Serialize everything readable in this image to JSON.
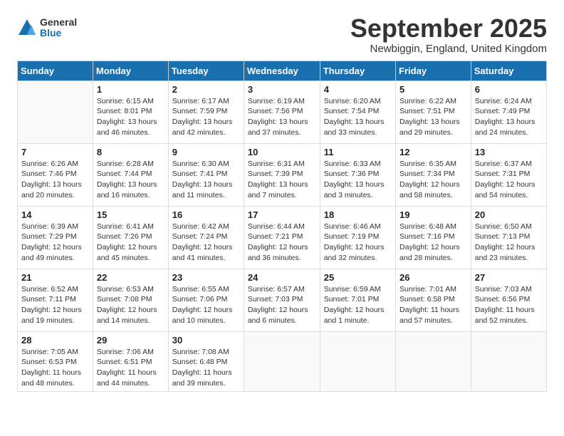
{
  "logo": {
    "general": "General",
    "blue": "Blue"
  },
  "title": "September 2025",
  "location": "Newbiggin, England, United Kingdom",
  "headers": [
    "Sunday",
    "Monday",
    "Tuesday",
    "Wednesday",
    "Thursday",
    "Friday",
    "Saturday"
  ],
  "weeks": [
    [
      {
        "day": "",
        "sunrise": "",
        "sunset": "",
        "daylight": ""
      },
      {
        "day": "1",
        "sunrise": "Sunrise: 6:15 AM",
        "sunset": "Sunset: 8:01 PM",
        "daylight": "Daylight: 13 hours and 46 minutes."
      },
      {
        "day": "2",
        "sunrise": "Sunrise: 6:17 AM",
        "sunset": "Sunset: 7:59 PM",
        "daylight": "Daylight: 13 hours and 42 minutes."
      },
      {
        "day": "3",
        "sunrise": "Sunrise: 6:19 AM",
        "sunset": "Sunset: 7:56 PM",
        "daylight": "Daylight: 13 hours and 37 minutes."
      },
      {
        "day": "4",
        "sunrise": "Sunrise: 6:20 AM",
        "sunset": "Sunset: 7:54 PM",
        "daylight": "Daylight: 13 hours and 33 minutes."
      },
      {
        "day": "5",
        "sunrise": "Sunrise: 6:22 AM",
        "sunset": "Sunset: 7:51 PM",
        "daylight": "Daylight: 13 hours and 29 minutes."
      },
      {
        "day": "6",
        "sunrise": "Sunrise: 6:24 AM",
        "sunset": "Sunset: 7:49 PM",
        "daylight": "Daylight: 13 hours and 24 minutes."
      }
    ],
    [
      {
        "day": "7",
        "sunrise": "Sunrise: 6:26 AM",
        "sunset": "Sunset: 7:46 PM",
        "daylight": "Daylight: 13 hours and 20 minutes."
      },
      {
        "day": "8",
        "sunrise": "Sunrise: 6:28 AM",
        "sunset": "Sunset: 7:44 PM",
        "daylight": "Daylight: 13 hours and 16 minutes."
      },
      {
        "day": "9",
        "sunrise": "Sunrise: 6:30 AM",
        "sunset": "Sunset: 7:41 PM",
        "daylight": "Daylight: 13 hours and 11 minutes."
      },
      {
        "day": "10",
        "sunrise": "Sunrise: 6:31 AM",
        "sunset": "Sunset: 7:39 PM",
        "daylight": "Daylight: 13 hours and 7 minutes."
      },
      {
        "day": "11",
        "sunrise": "Sunrise: 6:33 AM",
        "sunset": "Sunset: 7:36 PM",
        "daylight": "Daylight: 13 hours and 3 minutes."
      },
      {
        "day": "12",
        "sunrise": "Sunrise: 6:35 AM",
        "sunset": "Sunset: 7:34 PM",
        "daylight": "Daylight: 12 hours and 58 minutes."
      },
      {
        "day": "13",
        "sunrise": "Sunrise: 6:37 AM",
        "sunset": "Sunset: 7:31 PM",
        "daylight": "Daylight: 12 hours and 54 minutes."
      }
    ],
    [
      {
        "day": "14",
        "sunrise": "Sunrise: 6:39 AM",
        "sunset": "Sunset: 7:29 PM",
        "daylight": "Daylight: 12 hours and 49 minutes."
      },
      {
        "day": "15",
        "sunrise": "Sunrise: 6:41 AM",
        "sunset": "Sunset: 7:26 PM",
        "daylight": "Daylight: 12 hours and 45 minutes."
      },
      {
        "day": "16",
        "sunrise": "Sunrise: 6:42 AM",
        "sunset": "Sunset: 7:24 PM",
        "daylight": "Daylight: 12 hours and 41 minutes."
      },
      {
        "day": "17",
        "sunrise": "Sunrise: 6:44 AM",
        "sunset": "Sunset: 7:21 PM",
        "daylight": "Daylight: 12 hours and 36 minutes."
      },
      {
        "day": "18",
        "sunrise": "Sunrise: 6:46 AM",
        "sunset": "Sunset: 7:19 PM",
        "daylight": "Daylight: 12 hours and 32 minutes."
      },
      {
        "day": "19",
        "sunrise": "Sunrise: 6:48 AM",
        "sunset": "Sunset: 7:16 PM",
        "daylight": "Daylight: 12 hours and 28 minutes."
      },
      {
        "day": "20",
        "sunrise": "Sunrise: 6:50 AM",
        "sunset": "Sunset: 7:13 PM",
        "daylight": "Daylight: 12 hours and 23 minutes."
      }
    ],
    [
      {
        "day": "21",
        "sunrise": "Sunrise: 6:52 AM",
        "sunset": "Sunset: 7:11 PM",
        "daylight": "Daylight: 12 hours and 19 minutes."
      },
      {
        "day": "22",
        "sunrise": "Sunrise: 6:53 AM",
        "sunset": "Sunset: 7:08 PM",
        "daylight": "Daylight: 12 hours and 14 minutes."
      },
      {
        "day": "23",
        "sunrise": "Sunrise: 6:55 AM",
        "sunset": "Sunset: 7:06 PM",
        "daylight": "Daylight: 12 hours and 10 minutes."
      },
      {
        "day": "24",
        "sunrise": "Sunrise: 6:57 AM",
        "sunset": "Sunset: 7:03 PM",
        "daylight": "Daylight: 12 hours and 6 minutes."
      },
      {
        "day": "25",
        "sunrise": "Sunrise: 6:59 AM",
        "sunset": "Sunset: 7:01 PM",
        "daylight": "Daylight: 12 hours and 1 minute."
      },
      {
        "day": "26",
        "sunrise": "Sunrise: 7:01 AM",
        "sunset": "Sunset: 6:58 PM",
        "daylight": "Daylight: 11 hours and 57 minutes."
      },
      {
        "day": "27",
        "sunrise": "Sunrise: 7:03 AM",
        "sunset": "Sunset: 6:56 PM",
        "daylight": "Daylight: 11 hours and 52 minutes."
      }
    ],
    [
      {
        "day": "28",
        "sunrise": "Sunrise: 7:05 AM",
        "sunset": "Sunset: 6:53 PM",
        "daylight": "Daylight: 11 hours and 48 minutes."
      },
      {
        "day": "29",
        "sunrise": "Sunrise: 7:06 AM",
        "sunset": "Sunset: 6:51 PM",
        "daylight": "Daylight: 11 hours and 44 minutes."
      },
      {
        "day": "30",
        "sunrise": "Sunrise: 7:08 AM",
        "sunset": "Sunset: 6:48 PM",
        "daylight": "Daylight: 11 hours and 39 minutes."
      },
      {
        "day": "",
        "sunrise": "",
        "sunset": "",
        "daylight": ""
      },
      {
        "day": "",
        "sunrise": "",
        "sunset": "",
        "daylight": ""
      },
      {
        "day": "",
        "sunrise": "",
        "sunset": "",
        "daylight": ""
      },
      {
        "day": "",
        "sunrise": "",
        "sunset": "",
        "daylight": ""
      }
    ]
  ]
}
